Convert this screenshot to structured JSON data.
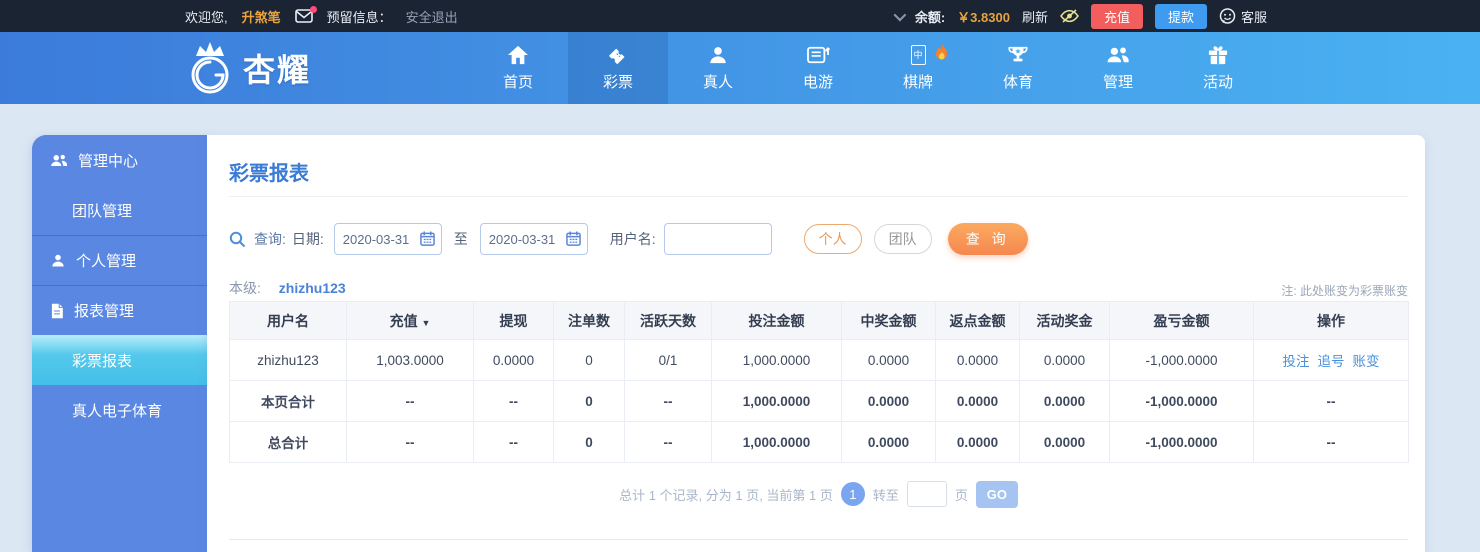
{
  "topbar": {
    "welcome_label": "欢迎您,",
    "username": "升煞笔",
    "reserved_label": "预留信息：",
    "logout_label": "安全退出",
    "balance_label": "余额:",
    "balance_value": "￥3.8300",
    "refresh_label": "刷新",
    "recharge_label": "充值",
    "withdraw_label": "提款",
    "service_label": "客服"
  },
  "nav": {
    "brand": "杏耀",
    "items": [
      {
        "label": "首页",
        "icon": "home-icon",
        "active": false
      },
      {
        "label": "彩票",
        "icon": "ticket-icon",
        "active": true
      },
      {
        "label": "真人",
        "icon": "person-icon",
        "active": false
      },
      {
        "label": "电游",
        "icon": "slot-machine-icon",
        "active": false
      },
      {
        "label": "棋牌",
        "icon": "mahjong-icon",
        "active": false,
        "hot": true,
        "tile_char": "中"
      },
      {
        "label": "体育",
        "icon": "trophy-icon",
        "active": false
      },
      {
        "label": "管理",
        "icon": "users-icon",
        "active": false
      },
      {
        "label": "活动",
        "icon": "gift-icon",
        "active": false
      }
    ]
  },
  "sidebar": {
    "items": [
      {
        "label": "管理中心",
        "icon": "users-icon",
        "active": false
      },
      {
        "label": "团队管理",
        "active": false
      },
      {
        "label": "个人管理",
        "icon": "user-icon",
        "active": false
      },
      {
        "label": "报表管理",
        "icon": "document-icon",
        "active": false
      },
      {
        "label": "彩票报表",
        "active": true
      },
      {
        "label": "真人电子体育",
        "active": false
      }
    ]
  },
  "main": {
    "title": "彩票报表",
    "search": {
      "query_label": "查询:",
      "date_label": "日期:",
      "date_from": "2020-03-31",
      "to_label": "至",
      "date_to": "2020-03-31",
      "username_label": "用户名:",
      "username_value": "",
      "personal_btn": "个人",
      "team_btn": "团队",
      "search_btn": "查 询"
    },
    "level_label": "本级:",
    "level_user": "zhizhu123",
    "note": "注: 此处账变为彩票账变",
    "table": {
      "headers": [
        "用户名",
        "充值",
        "提现",
        "注单数",
        "活跃天数",
        "投注金额",
        "中奖金额",
        "返点金额",
        "活动奖金",
        "盈亏金额",
        "操作"
      ],
      "sort_indicator": "▼",
      "rows": [
        {
          "cells": [
            "zhizhu123",
            "1,003.0000",
            "0.0000",
            "0",
            "0/1",
            "1,000.0000",
            "0.0000",
            "0.0000",
            "0.0000",
            "-1,000.0000"
          ]
        },
        {
          "cells": [
            "本页合计",
            "--",
            "--",
            "0",
            "--",
            "1,000.0000",
            "0.0000",
            "0.0000",
            "0.0000",
            "-1,000.0000"
          ],
          "op": "--"
        },
        {
          "cells": [
            "总合计",
            "--",
            "--",
            "0",
            "--",
            "1,000.0000",
            "0.0000",
            "0.0000",
            "0.0000",
            "-1,000.0000"
          ],
          "op": "--"
        }
      ],
      "actions": [
        "投注",
        "追号",
        "账变"
      ]
    },
    "pagination": {
      "summary": "总计 1 个记录, 分为 1 页, 当前第 1 页",
      "current_page": "1",
      "goto_label": "转至",
      "page_label": "页",
      "go_btn": "GO"
    }
  },
  "colors": {
    "topbar_bg": "#1b2433",
    "accent_orange": "#e8a33d",
    "nav_gradient_start": "#3c7bda",
    "nav_gradient_end": "#4ab2f2",
    "sidebar_bg": "#5a87e2",
    "sidebar_active": "#4cc4ec",
    "title_blue": "#3a7bd5",
    "recharge_red": "#f25d5d",
    "withdraw_blue": "#3f9bf0",
    "negative_red": "#e11d1d",
    "link_blue": "#4a90d9",
    "search_orange": "#f5874f"
  }
}
